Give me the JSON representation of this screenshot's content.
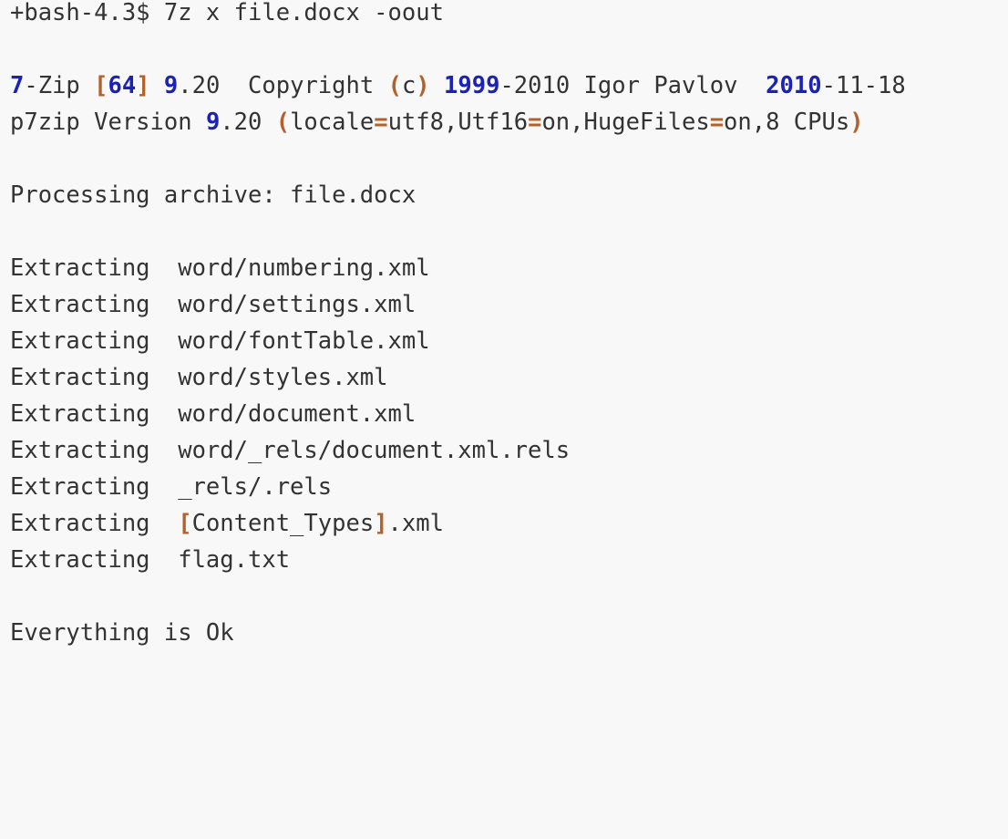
{
  "terminal": {
    "prompt_line": "+bash-4.3$ 7z x file.docx -oout",
    "header_line1": {
      "p1": "7",
      "p2": "-Zip ",
      "p3": "[",
      "p4": "64",
      "p5": "]",
      "p6": " ",
      "p7": "9",
      "p8": ".20  Copyright ",
      "p9": "(",
      "p10": "c",
      "p11": ")",
      "p12": " ",
      "p13": "1999",
      "p14": "-2010 Igor Pavlov  ",
      "p15": "2010",
      "p16": "-11-18"
    },
    "header_line2": {
      "p1": "p7zip Version ",
      "p2": "9",
      "p3": ".20 ",
      "p4": "(",
      "p5": "locale",
      "p6": "=",
      "p7": "utf8,Utf16",
      "p8": "=",
      "p9": "on,HugeFiles",
      "p10": "=",
      "p11": "on,8 CPUs",
      "p12": ")"
    },
    "processing_line": "Processing archive: file.docx",
    "extract_lines": [
      "Extracting  word/numbering.xml",
      "Extracting  word/settings.xml",
      "Extracting  word/fontTable.xml",
      "Extracting  word/styles.xml",
      "Extracting  word/document.xml",
      "Extracting  word/_rels/document.xml.rels",
      "Extracting  _rels/.rels"
    ],
    "content_types_line": {
      "p1": "Extracting  ",
      "p2": "[",
      "p3": "Content_Types",
      "p4": "]",
      "p5": ".xml"
    },
    "flag_line": "Extracting  flag.txt",
    "status_line": "Everything is Ok"
  },
  "colors": {
    "background": "#f8f8f8",
    "text": "#333333",
    "number_highlight": "#1c22b3",
    "punctuation_highlight": "#b3602b"
  }
}
